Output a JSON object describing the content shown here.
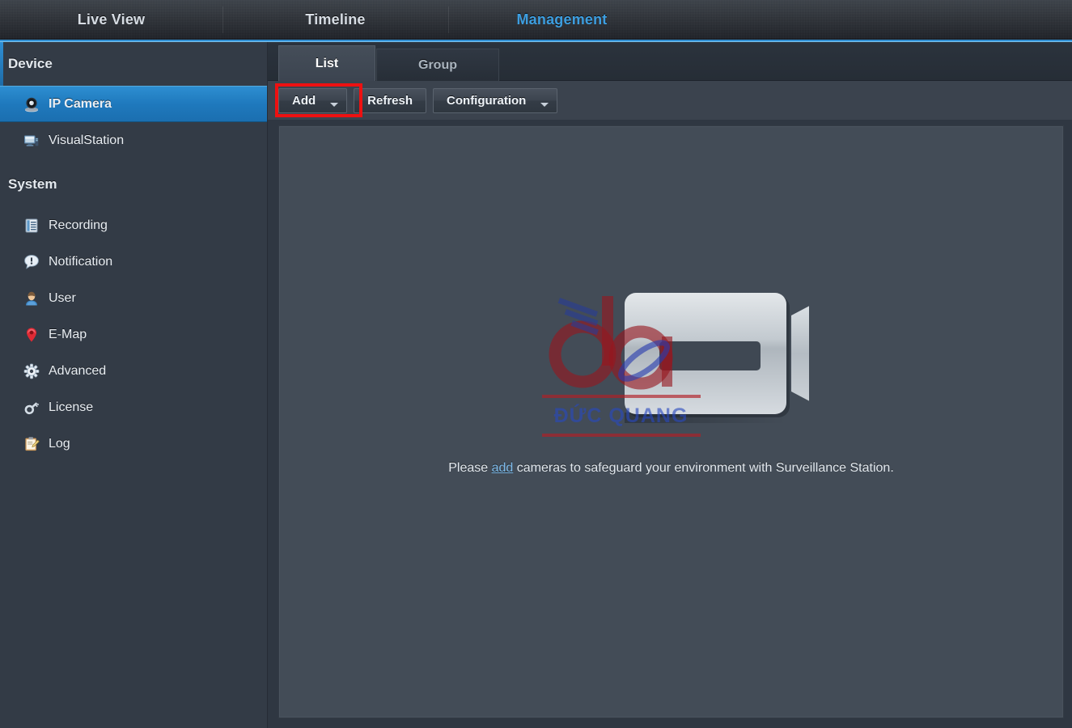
{
  "header": {
    "tabs": [
      {
        "label": "Live View",
        "active": false
      },
      {
        "label": "Timeline",
        "active": false
      },
      {
        "label": "Management",
        "active": true
      }
    ]
  },
  "sidebar": {
    "groups": [
      {
        "title": "Device"
      },
      {
        "title": "System"
      }
    ],
    "device_title": "Device",
    "system_title": "System",
    "device_items": [
      {
        "label": "IP Camera",
        "icon": "ip-camera-icon",
        "selected": true
      },
      {
        "label": "VisualStation",
        "icon": "visualstation-icon",
        "selected": false
      }
    ],
    "system_items": [
      {
        "label": "Recording",
        "icon": "recording-icon"
      },
      {
        "label": "Notification",
        "icon": "notification-icon"
      },
      {
        "label": "User",
        "icon": "user-icon"
      },
      {
        "label": "E-Map",
        "icon": "emap-icon"
      },
      {
        "label": "Advanced",
        "icon": "advanced-icon"
      },
      {
        "label": "License",
        "icon": "license-icon"
      },
      {
        "label": "Log",
        "icon": "log-icon"
      }
    ]
  },
  "panel": {
    "tabs": {
      "list": "List",
      "group": "Group"
    },
    "toolbar": {
      "add": "Add",
      "refresh": "Refresh",
      "configuration": "Configuration"
    },
    "empty": {
      "text_before": "Please ",
      "link": "add",
      "text_after": " cameras to safeguard your environment with Surveillance Station."
    }
  },
  "watermark": {
    "text": "ĐỨC QUANG",
    "logo": "dq"
  },
  "colors": {
    "accent_blue": "#2f8fd4",
    "active_tab_text": "#3d9ee0",
    "selected_item_blue": "#1f79bd",
    "highlight_red": "#ee1111",
    "link_blue": "#7db9e8",
    "panel_bg": "#434c57",
    "sidebar_bg": "#333b46"
  }
}
